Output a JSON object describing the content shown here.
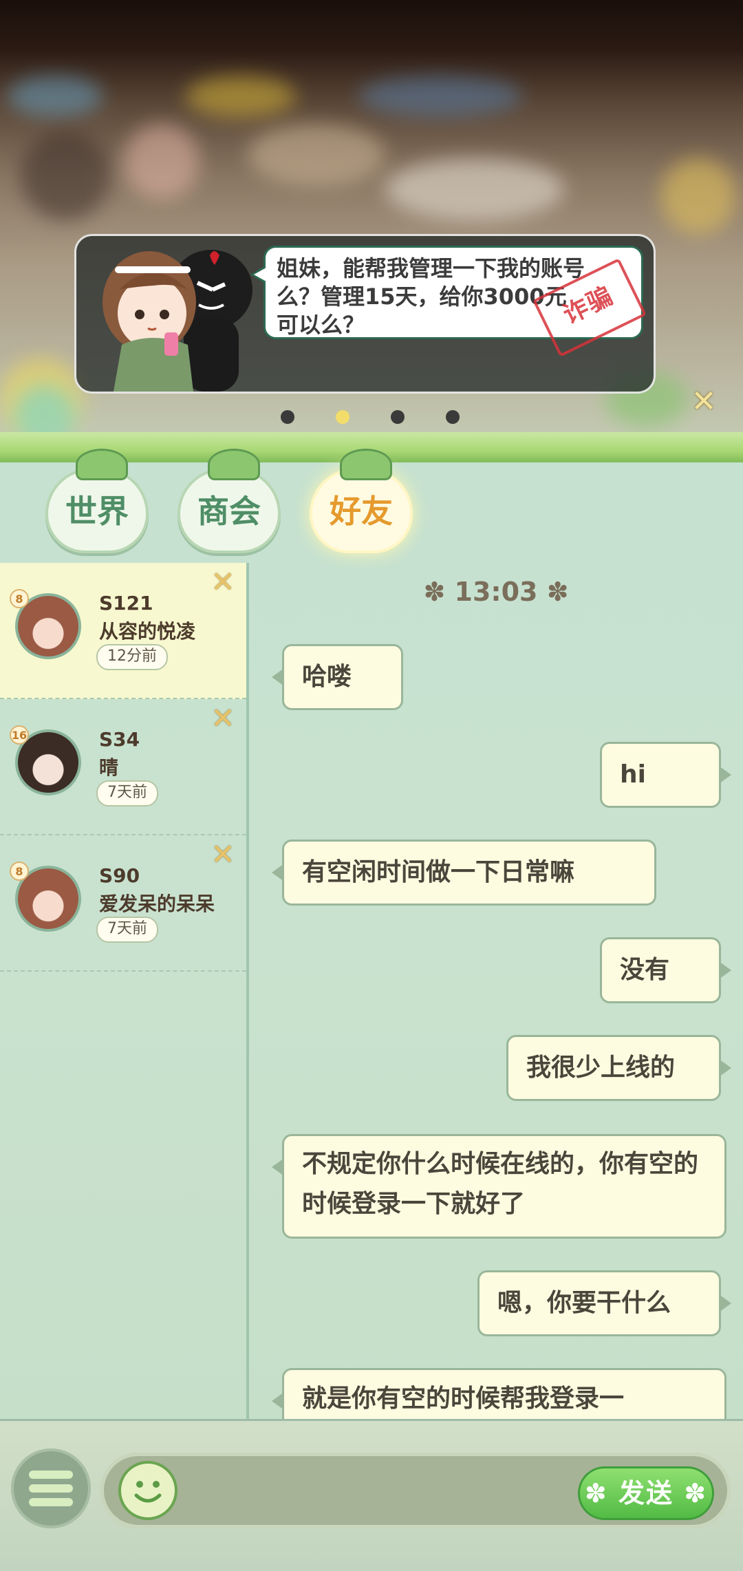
{
  "banner": {
    "text_lines": [
      "姐妹，能帮我管理一下我的账号",
      "么？管理15天，给你3000元",
      "可以么？"
    ],
    "stamp": "诈骗",
    "close_icon": "close-x-icon",
    "page_indicator": {
      "total": 4,
      "active_index": 1
    }
  },
  "tabs": [
    {
      "label": "世界",
      "active": false
    },
    {
      "label": "商会",
      "active": false
    },
    {
      "label": "好友",
      "active": true
    }
  ],
  "friends": [
    {
      "server": "S121",
      "name": "从容的悦凌",
      "time": "12分前",
      "level": "8",
      "active": true
    },
    {
      "server": "S34",
      "name": "晴",
      "time": "7天前",
      "level": "16",
      "active": false
    },
    {
      "server": "S90",
      "name": "爱发呆的呆呆",
      "time": "7天前",
      "level": "8",
      "active": false
    }
  ],
  "chat": {
    "timestamp": "✽ 13:03 ✽",
    "messages": [
      {
        "side": "left",
        "text": "哈喽"
      },
      {
        "side": "right",
        "text": "hi"
      },
      {
        "side": "left",
        "text": "有空闲时间做一下日常嘛"
      },
      {
        "side": "right",
        "text": "没有"
      },
      {
        "side": "right",
        "text": "我很少上线的"
      },
      {
        "side": "left",
        "text": "不规定你什么时候在线的，你有空的时候登录一下就好了"
      },
      {
        "side": "right",
        "text": "嗯，你要干什么"
      },
      {
        "side": "left",
        "text": "就是你有空的时候帮我登录一"
      }
    ]
  },
  "input": {
    "menu_icon": "hamburger-menu-icon",
    "emoji_icon": "smiley-emoji-icon",
    "send_label": "✽ 发送 ✽"
  },
  "colors": {
    "accent_active_tab": "#e59a2d",
    "tab_text": "#4f8e66",
    "send_button": "#52bb45",
    "stamp_red": "#d8333a"
  }
}
